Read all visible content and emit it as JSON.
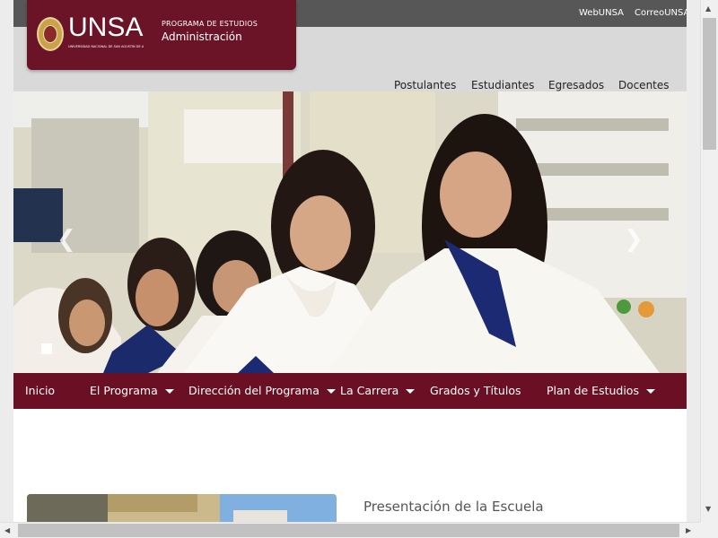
{
  "topbar": {
    "links": [
      "WebUNSA",
      "CorreoUNSA"
    ]
  },
  "brand": {
    "logo_text": "UNSA",
    "logo_subtext": "UNIVERSIDAD NACIONAL DE SAN AGUSTIN DE AREQUIPA",
    "program_label": "PROGRAMA DE ESTUDIOS",
    "program_name": "Administración",
    "color": "#6b1427"
  },
  "header_nav": [
    "Postulantes",
    "Estudiantes",
    "Egresados",
    "Docentes"
  ],
  "carousel": {
    "prev_icon": "chevron-left-icon",
    "next_icon": "chevron-right-icon",
    "indicator_count": 1
  },
  "main_menu": {
    "color": "#6b0f24",
    "items": [
      {
        "label": "Inicio",
        "dropdown": false
      },
      {
        "label": "El Programa",
        "dropdown": true
      },
      {
        "label": "Dirección del Programa",
        "dropdown": true
      },
      {
        "label": "La Carrera",
        "dropdown": true
      },
      {
        "label": "Grados y Títulos",
        "dropdown": false
      },
      {
        "label": "Plan de Estudios",
        "dropdown": true
      }
    ]
  },
  "content": {
    "section_title": "Presentación de la Escuela"
  },
  "scrollbars": {
    "up": "▲",
    "down": "▼",
    "left": "◀",
    "right": "▶"
  }
}
